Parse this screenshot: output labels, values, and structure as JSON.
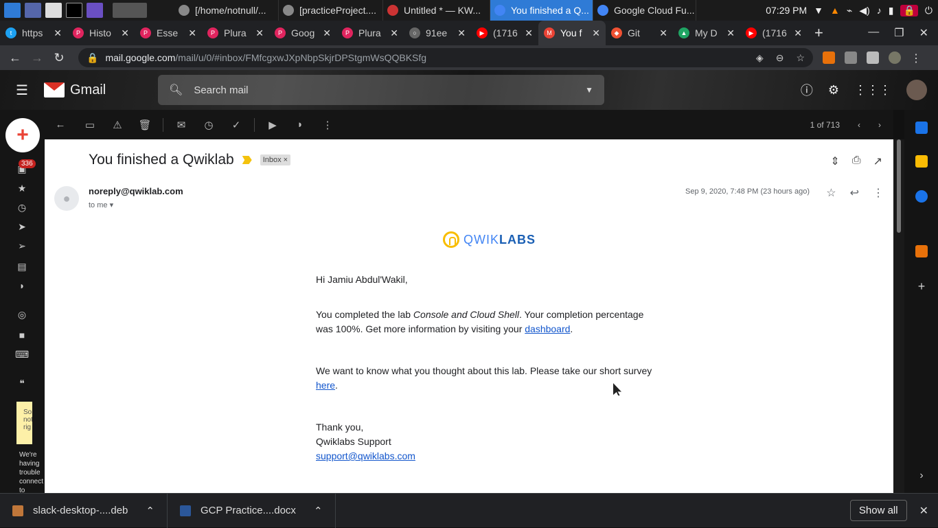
{
  "taskbar": {
    "tasks": [
      {
        "title": "[/home/notnull/...",
        "icon": "folder-icon"
      },
      {
        "title": "[practiceProject....",
        "icon": "document-icon"
      },
      {
        "title": "Untitled * — KW...",
        "icon": "kwrite-icon"
      },
      {
        "title": "You finished a Q...",
        "icon": "chrome-icon",
        "active": true
      },
      {
        "title": "Google Cloud Fu...",
        "icon": "chrome-icon"
      }
    ],
    "clock": "07:29 PM"
  },
  "tabs": [
    {
      "title": "https",
      "color": "#1da1f2",
      "glyph": "t"
    },
    {
      "title": "Histo",
      "color": "#e0245e",
      "glyph": "P"
    },
    {
      "title": "Esse",
      "color": "#e0245e",
      "glyph": "P"
    },
    {
      "title": "Plura",
      "color": "#e0245e",
      "glyph": "P"
    },
    {
      "title": "Goog",
      "color": "#e0245e",
      "glyph": "P"
    },
    {
      "title": "Plura",
      "color": "#e0245e",
      "glyph": "P"
    },
    {
      "title": "91ee",
      "color": "#666",
      "glyph": "○"
    },
    {
      "title": "(1716",
      "color": "#ff0000",
      "glyph": "▶"
    },
    {
      "title": "You f",
      "color": "#ea4335",
      "glyph": "M",
      "active": true
    },
    {
      "title": "Git",
      "color": "#f05133",
      "glyph": "◆"
    },
    {
      "title": "My D",
      "color": "#1fa463",
      "glyph": "▲"
    },
    {
      "title": "(1716",
      "color": "#ff0000",
      "glyph": "▶"
    }
  ],
  "address": {
    "host": "mail.google.com",
    "path": "/mail/u/0/#inbox/FMfcgxwJXpNbpSkjrDPStgmWsQQBKSfg"
  },
  "gmail": {
    "brand": "Gmail",
    "search_placeholder": "Search mail",
    "inbox_count": "336",
    "pager": "1 of 713",
    "note_text": "Some not rig",
    "trouble_text": "We're having trouble connect to"
  },
  "email": {
    "subject": "You finished a Qwiklab",
    "label": "Inbox",
    "sender": "noreply@qwiklab.com",
    "to": "to me",
    "date": "Sep 9, 2020, 7:48 PM (23 hours ago)",
    "logo_part1": "QWIK",
    "logo_part2": "LABS",
    "greeting": "Hi Jamiu Abdul'Wakil,",
    "p1_before": "You completed the lab ",
    "p1_lab": "Console and Cloud Shell",
    "p1_after": ". Your completion percentage was 100%. Get more information by visiting your ",
    "p1_link": "dashboard",
    "p1_end": ".",
    "p2_before": "We want to know what you thought about this lab. Please take our short survey ",
    "p2_link": "here",
    "p2_end": ".",
    "signoff": "Thank you,",
    "team": "Qwiklabs Support",
    "support_email": "support@qwiklabs.com"
  },
  "downloads": [
    {
      "name": "slack-desktop-....deb",
      "color": "#c0773a"
    },
    {
      "name": "GCP Practice....docx",
      "color": "#2b579a"
    }
  ],
  "downloads_show_all": "Show all"
}
